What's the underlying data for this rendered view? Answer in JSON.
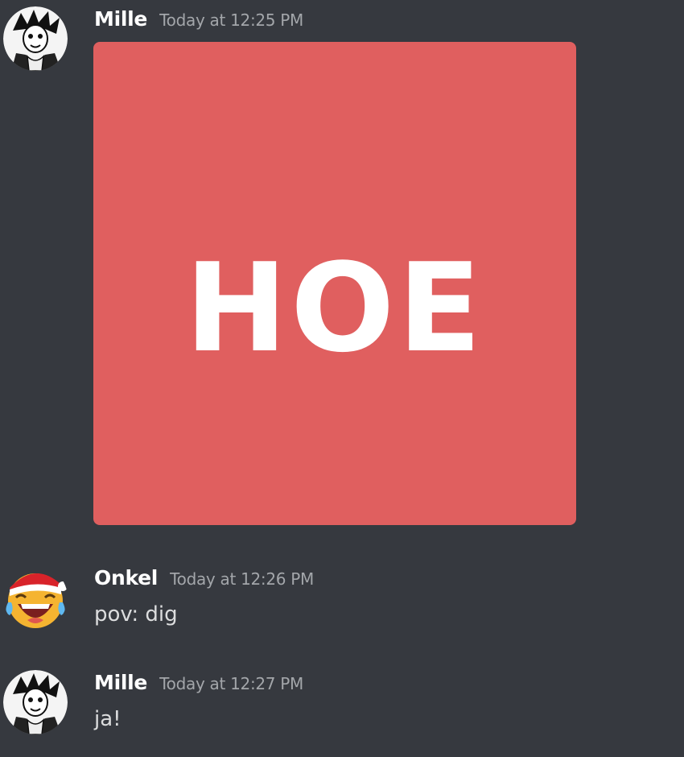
{
  "colors": {
    "background": "#36393f",
    "username": "#ffffff",
    "timestamp": "#a3a6aa",
    "message_text": "#dcddde",
    "attachment_background": "#e05f5f",
    "attachment_text": "#ffffff"
  },
  "messages": [
    {
      "author": "Mille",
      "timestamp": "Today at 12:25 PM",
      "avatar": "anime-character-avatar-icon",
      "attachment": {
        "type": "image",
        "text": "HOE"
      }
    },
    {
      "author": "Onkel",
      "timestamp": "Today at 12:26 PM",
      "avatar": "laughing-emoji-santa-hat-avatar-icon",
      "text": "pov: dig"
    },
    {
      "author": "Mille",
      "timestamp": "Today at 12:27 PM",
      "avatar": "anime-character-avatar-icon",
      "text": "ja!"
    }
  ]
}
